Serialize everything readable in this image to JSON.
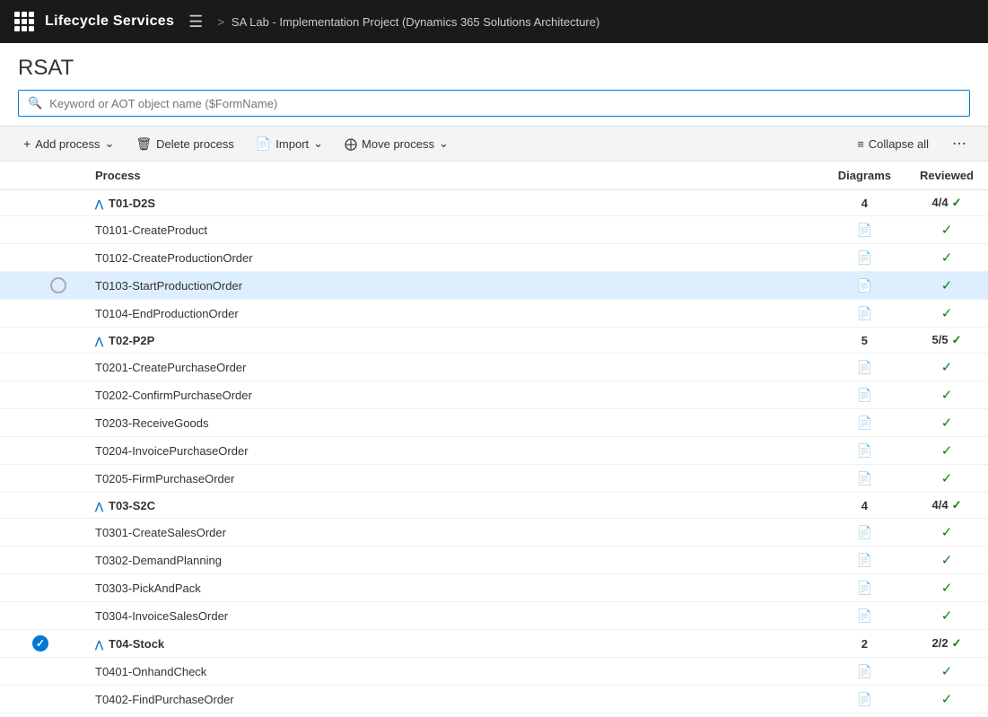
{
  "header": {
    "app_title": "Lifecycle Services",
    "hamburger_label": "☰",
    "breadcrumb_arrow": ">",
    "breadcrumb_text": "SA Lab - Implementation Project (Dynamics 365 Solutions Architecture)"
  },
  "page": {
    "title": "RSAT"
  },
  "search": {
    "placeholder": "Keyword or AOT object name ($FormName)"
  },
  "toolbar": {
    "add_process": "Add process",
    "delete_process": "Delete process",
    "import": "Import",
    "move_process": "Move process",
    "collapse_all": "Collapse all"
  },
  "table": {
    "col_process": "Process",
    "col_diagrams": "Diagrams",
    "col_reviewed": "Reviewed"
  },
  "rows": [
    {
      "type": "group",
      "id": "T01-D2S",
      "label": "T01-D2S",
      "diagrams": "4",
      "reviewed": "4/4",
      "selected": false,
      "checked": false
    },
    {
      "type": "child",
      "id": "T0101-CreateProduct",
      "label": "T0101-CreateProduct",
      "selected": false,
      "checked": false
    },
    {
      "type": "child",
      "id": "T0102-CreateProductionOrder",
      "label": "T0102-CreateProductionOrder",
      "selected": false,
      "checked": false
    },
    {
      "type": "child",
      "id": "T0103-StartProductionOrder",
      "label": "T0103-StartProductionOrder",
      "selected": true,
      "checked": false,
      "radio": true
    },
    {
      "type": "child",
      "id": "T0104-EndProductionOrder",
      "label": "T0104-EndProductionOrder",
      "selected": false,
      "checked": false
    },
    {
      "type": "group",
      "id": "T02-P2P",
      "label": "T02-P2P",
      "diagrams": "5",
      "reviewed": "5/5",
      "selected": false,
      "checked": false
    },
    {
      "type": "child",
      "id": "T0201-CreatePurchaseOrder",
      "label": "T0201-CreatePurchaseOrder",
      "selected": false,
      "checked": false
    },
    {
      "type": "child",
      "id": "T0202-ConfirmPurchaseOrder",
      "label": "T0202-ConfirmPurchaseOrder",
      "selected": false,
      "checked": false
    },
    {
      "type": "child",
      "id": "T0203-ReceiveGoods",
      "label": "T0203-ReceiveGoods",
      "selected": false,
      "checked": false
    },
    {
      "type": "child",
      "id": "T0204-InvoicePurchaseOrder",
      "label": "T0204-InvoicePurchaseOrder",
      "selected": false,
      "checked": false
    },
    {
      "type": "child",
      "id": "T0205-FirmPurchaseOrder",
      "label": "T0205-FirmPurchaseOrder",
      "selected": false,
      "checked": false
    },
    {
      "type": "group",
      "id": "T03-S2C",
      "label": "T03-S2C",
      "diagrams": "4",
      "reviewed": "4/4",
      "selected": false,
      "checked": false
    },
    {
      "type": "child",
      "id": "T0301-CreateSalesOrder",
      "label": "T0301-CreateSalesOrder",
      "selected": false,
      "checked": false
    },
    {
      "type": "child",
      "id": "T0302-DemandPlanning",
      "label": "T0302-DemandPlanning",
      "selected": false,
      "checked": false
    },
    {
      "type": "child",
      "id": "T0303-PickAndPack",
      "label": "T0303-PickAndPack",
      "selected": false,
      "checked": false
    },
    {
      "type": "child",
      "id": "T0304-InvoiceSalesOrder",
      "label": "T0304-InvoiceSalesOrder",
      "selected": false,
      "checked": false
    },
    {
      "type": "group",
      "id": "T04-Stock",
      "label": "T04-Stock",
      "diagrams": "2",
      "reviewed": "2/2",
      "selected": false,
      "checked": true
    },
    {
      "type": "child",
      "id": "T0401-OnhandCheck",
      "label": "T0401-OnhandCheck",
      "selected": false,
      "checked": false
    },
    {
      "type": "child",
      "id": "T0402-FindPurchaseOrder",
      "label": "T0402-FindPurchaseOrder",
      "selected": false,
      "checked": false
    }
  ]
}
